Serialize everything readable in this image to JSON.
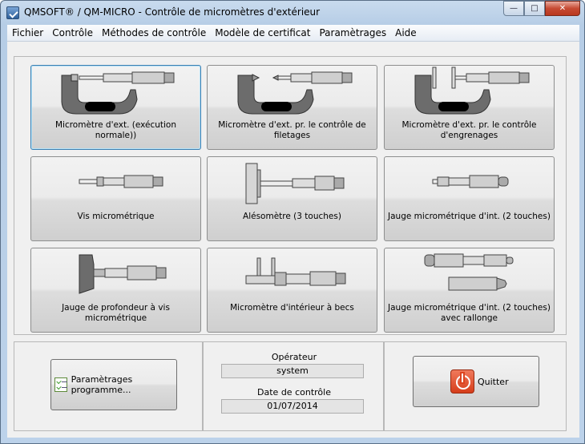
{
  "window": {
    "title": "QMSOFT® / QM-MICRO - Contrôle de micromètres d'extérieur"
  },
  "menu": [
    "Fichier",
    "Contrôle",
    "Méthodes de contrôle",
    "Modèle de certificat",
    "Paramètrages",
    "Aide"
  ],
  "tools": [
    {
      "label": "Micromètre d'ext. (exécution normale))",
      "icon": "outside-micrometer-icon"
    },
    {
      "label": "Micromètre d'ext. pr. le contrôle de filetages",
      "icon": "thread-micrometer-icon"
    },
    {
      "label": "Micromètre d'ext. pr. le contrôle d'engrenages",
      "icon": "gear-micrometer-icon"
    },
    {
      "label": "Vis micrométrique",
      "icon": "micrometer-head-icon"
    },
    {
      "label": "Alésomètre (3 touches)",
      "icon": "bore-gauge-icon"
    },
    {
      "label": "Jauge micrométrique d'int. (2 touches)",
      "icon": "inside-micrometer-gauge-icon"
    },
    {
      "label": "Jauge de profondeur à vis micrométrique",
      "icon": "depth-micrometer-icon"
    },
    {
      "label": "Micromètre d'intérieur à becs",
      "icon": "jaw-inside-micrometer-icon"
    },
    {
      "label": "Jauge micrométrique d'int. (2 touches) avec rallonge",
      "icon": "inside-micrometer-extension-icon"
    }
  ],
  "settings_button": "Paramètrages programme...",
  "operator": {
    "label": "Opérateur",
    "value": "system"
  },
  "check_date": {
    "label": "Date de contrôle",
    "value": "01/07/2014"
  },
  "quit_button": "Quitter",
  "accent": "#3c7fb1"
}
